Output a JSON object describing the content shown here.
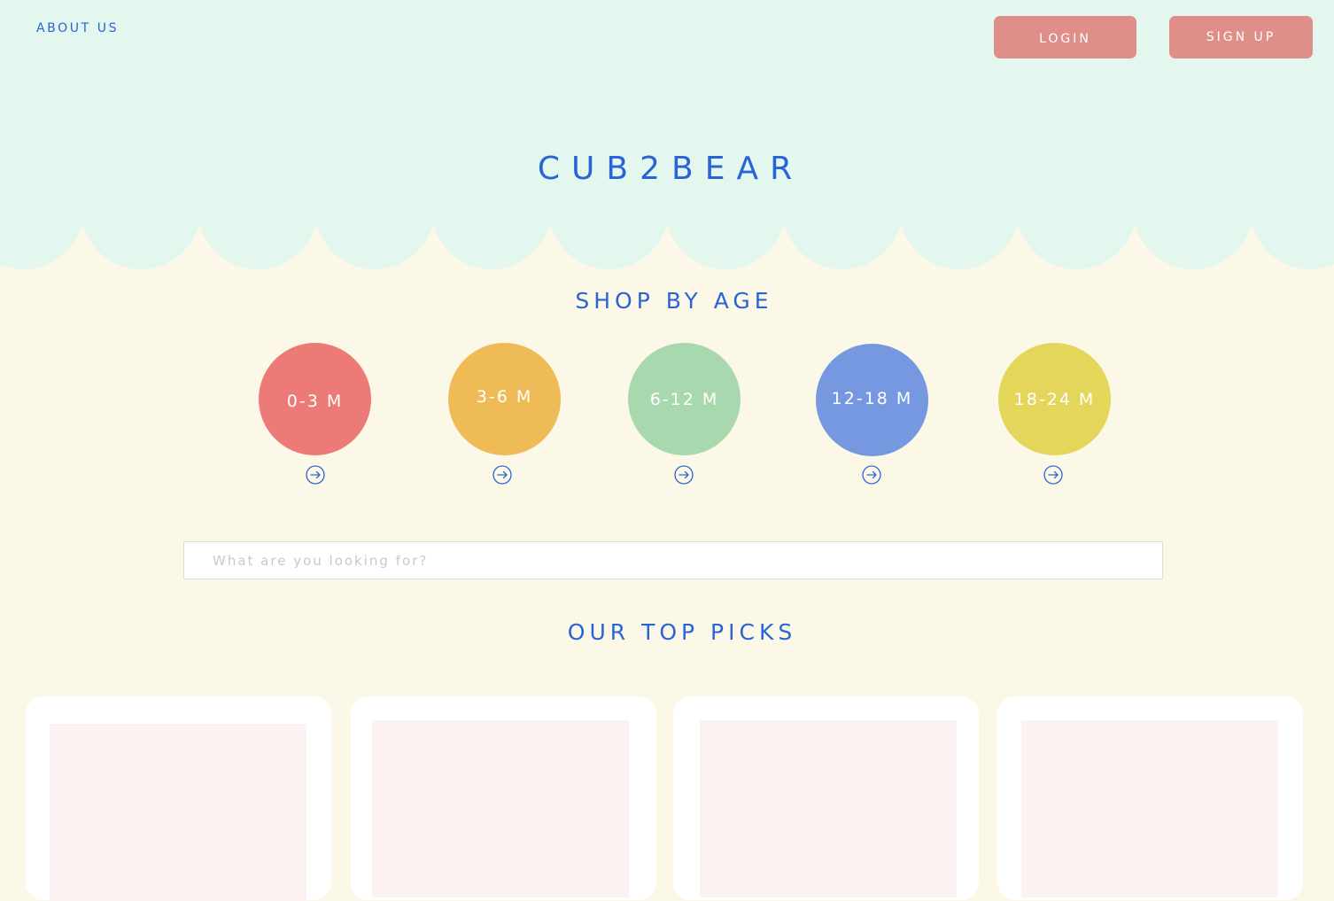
{
  "header": {
    "about_label": "ABOUT US",
    "login_label": "LOGIN",
    "signup_label": "SIGN UP",
    "brand": "CUB2BEAR"
  },
  "shop_by_age": {
    "title": "SHOP BY AGE",
    "items": [
      {
        "label": "0-3 M",
        "color": "#ec7b77"
      },
      {
        "label": "3-6 M",
        "color": "#efbb57"
      },
      {
        "label": "6-12 M",
        "color": "#a7d8ae"
      },
      {
        "label": "12-18 M",
        "color": "#7598e1"
      },
      {
        "label": "18-24 M",
        "color": "#e4d65a"
      }
    ],
    "arrow_icon": "arrow-right-circle-icon"
  },
  "search": {
    "placeholder": "What are you looking for?",
    "value": ""
  },
  "top_picks": {
    "title": "OUR TOP PICKS",
    "cards": [
      {
        "name": "product-card-1"
      },
      {
        "name": "product-card-2"
      },
      {
        "name": "product-card-3"
      },
      {
        "name": "product-card-4"
      }
    ]
  },
  "colors": {
    "accent_blue": "#2a63d6",
    "header_bg": "#e3f7ef",
    "page_bg": "#fcf8e8",
    "button_pink": "#e08e8a",
    "card_bg": "#ffffff",
    "card_image_bg": "#fdf2f2"
  }
}
